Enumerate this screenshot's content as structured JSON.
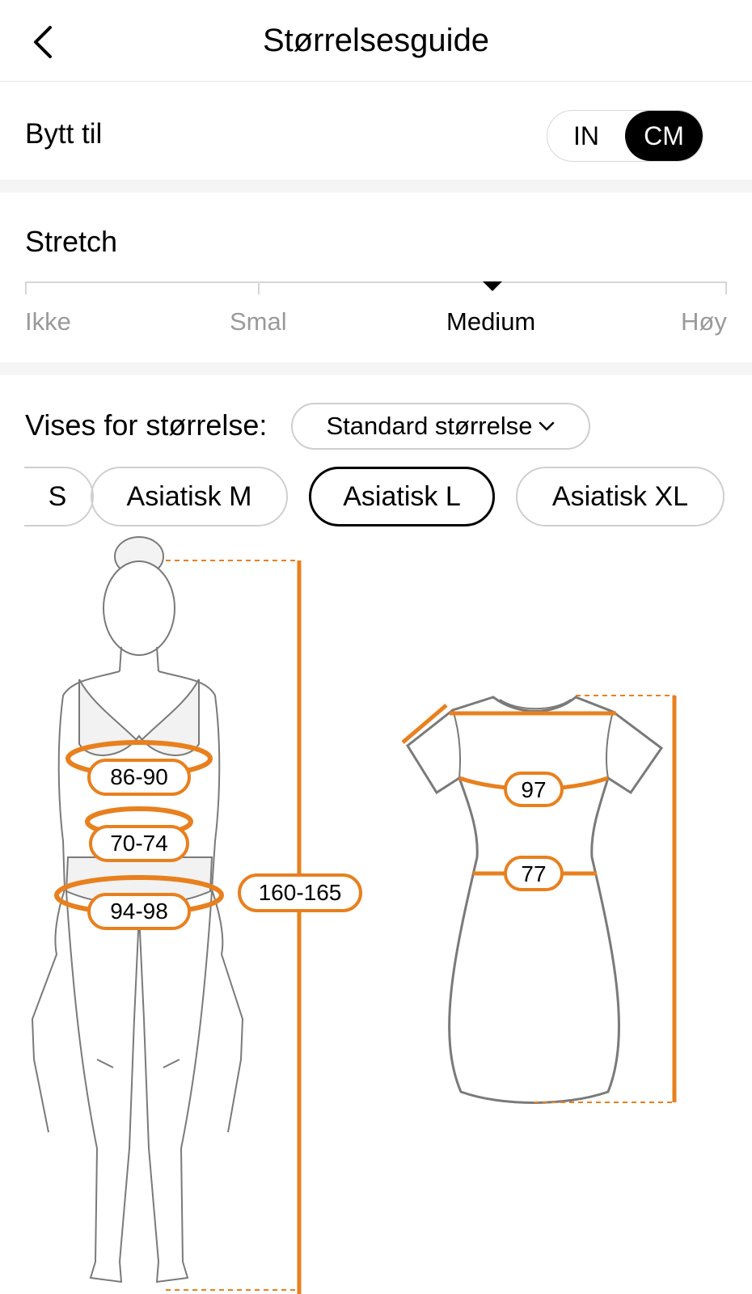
{
  "header": {
    "title": "Størrelsesguide",
    "back_icon": "chevron-left-icon"
  },
  "units": {
    "label": "Bytt til",
    "options": [
      "IN",
      "CM"
    ],
    "selected": "CM"
  },
  "stretch": {
    "title": "Stretch",
    "levels": [
      "Ikke",
      "Smal",
      "Medium",
      "Høy"
    ],
    "selected": "Medium"
  },
  "size_display": {
    "label": "Vises for størrelse:",
    "dropdown_value": "Standard størrelse",
    "dropdown_icon": "chevron-down-icon"
  },
  "size_chips": [
    {
      "label": "S",
      "selected": false
    },
    {
      "label": "Asiatisk M",
      "selected": false
    },
    {
      "label": "Asiatisk L",
      "selected": true
    },
    {
      "label": "Asiatisk XL",
      "selected": false
    }
  ],
  "body_measurements": {
    "bust": "86-90",
    "waist": "70-74",
    "hip": "94-98",
    "height": "160-165"
  },
  "garment_measurements": {
    "chest": "97",
    "waist": "77"
  },
  "colors": {
    "accent": "#E8801E",
    "outline": "#7a7a7a"
  }
}
